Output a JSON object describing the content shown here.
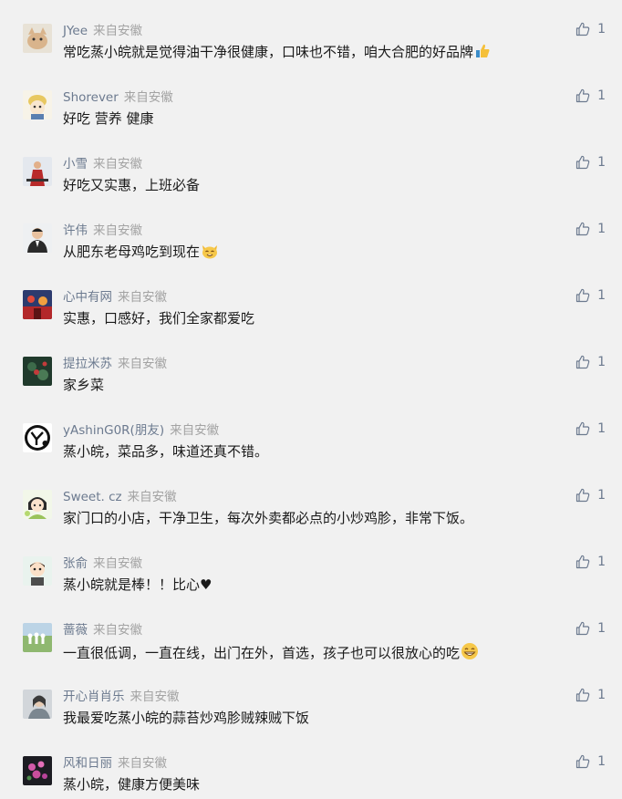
{
  "comments": [
    {
      "nickname": "JYee",
      "source": "来自安徽",
      "text": "常吃蒸小皖就是觉得油干净很健康，口味也不错，咱大合肥的好品牌",
      "emoji": "thumbs-up",
      "likes": "1"
    },
    {
      "nickname": "Shorever",
      "source": "来自安徽",
      "text": "好吃 营养 健康",
      "emoji": "",
      "likes": "1"
    },
    {
      "nickname": "小雪",
      "source": "来自安徽",
      "text": "好吃又实惠，上班必备",
      "emoji": "",
      "likes": "1"
    },
    {
      "nickname": "许伟",
      "source": "来自安徽",
      "text": "从肥东老母鸡吃到现在",
      "emoji": "cat",
      "likes": "1"
    },
    {
      "nickname": "心中有网",
      "source": "来自安徽",
      "text": "实惠，口感好，我们全家都爱吃",
      "emoji": "",
      "likes": "1"
    },
    {
      "nickname": "提拉米苏",
      "source": "来自安徽",
      "text": "家乡菜",
      "emoji": "",
      "likes": "1"
    },
    {
      "nickname": "yAshinG0R(朋友)",
      "source": "来自安徽",
      "text": "蒸小皖，菜品多，味道还真不错。",
      "emoji": "",
      "likes": "1"
    },
    {
      "nickname": "Sweet. cz",
      "source": "来自安徽",
      "text": "家门口的小店，干净卫生，每次外卖都必点的小炒鸡胗，非常下饭。",
      "emoji": "",
      "likes": "1"
    },
    {
      "nickname": "张俞",
      "source": "来自安徽",
      "text": "蒸小皖就是棒！！比心♥",
      "emoji": "",
      "likes": "1"
    },
    {
      "nickname": "蔷薇",
      "source": "来自安徽",
      "text": "一直很低调，一直在线，出门在外，首选，孩子也可以很放心的吃",
      "emoji": "grin",
      "likes": "1"
    },
    {
      "nickname": "开心肖肖乐",
      "source": "来自安徽",
      "text": "我最爱吃蒸小皖的蒜苔炒鸡胗贼辣贼下饭",
      "emoji": "",
      "likes": "1"
    },
    {
      "nickname": "风和日丽",
      "source": "来自安徽",
      "text": "蒸小皖，健康方便美味",
      "emoji": "",
      "likes": "1"
    }
  ]
}
